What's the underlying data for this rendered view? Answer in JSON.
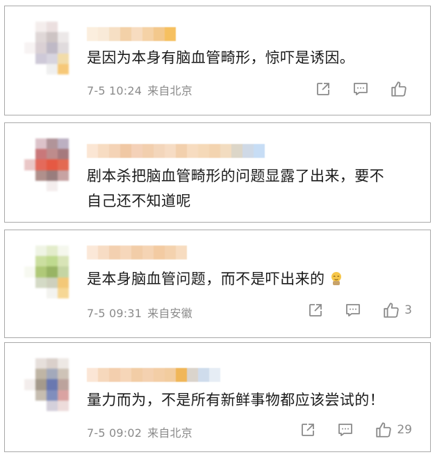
{
  "comments": [
    {
      "text": "是因为本身有脑血管畸形，惊吓是诱因。",
      "time": "7-5 10:24",
      "location": "来自北京",
      "like_count": ""
    },
    {
      "text_line1": "剧本杀把脑血管畸形的问题显露了出来，要不",
      "text_line2": "自己还不知道呢"
    },
    {
      "text": "是本身脑血管问题，而不是吓出来的",
      "time": "7-5 09:31",
      "location": "来自安徽",
      "like_count": "3"
    },
    {
      "text": "量力而为，不是所有新鲜事物都应该尝试的！",
      "time": "7-5 09:02",
      "location": "来自北京",
      "like_count": "29"
    }
  ],
  "icons": [
    "share-icon",
    "comment-icon",
    "like-icon",
    "emoji-face-icon"
  ],
  "colors": {
    "text": "#1a1a1a",
    "meta": "#8a8a8a",
    "border": "#a8a8a8"
  }
}
